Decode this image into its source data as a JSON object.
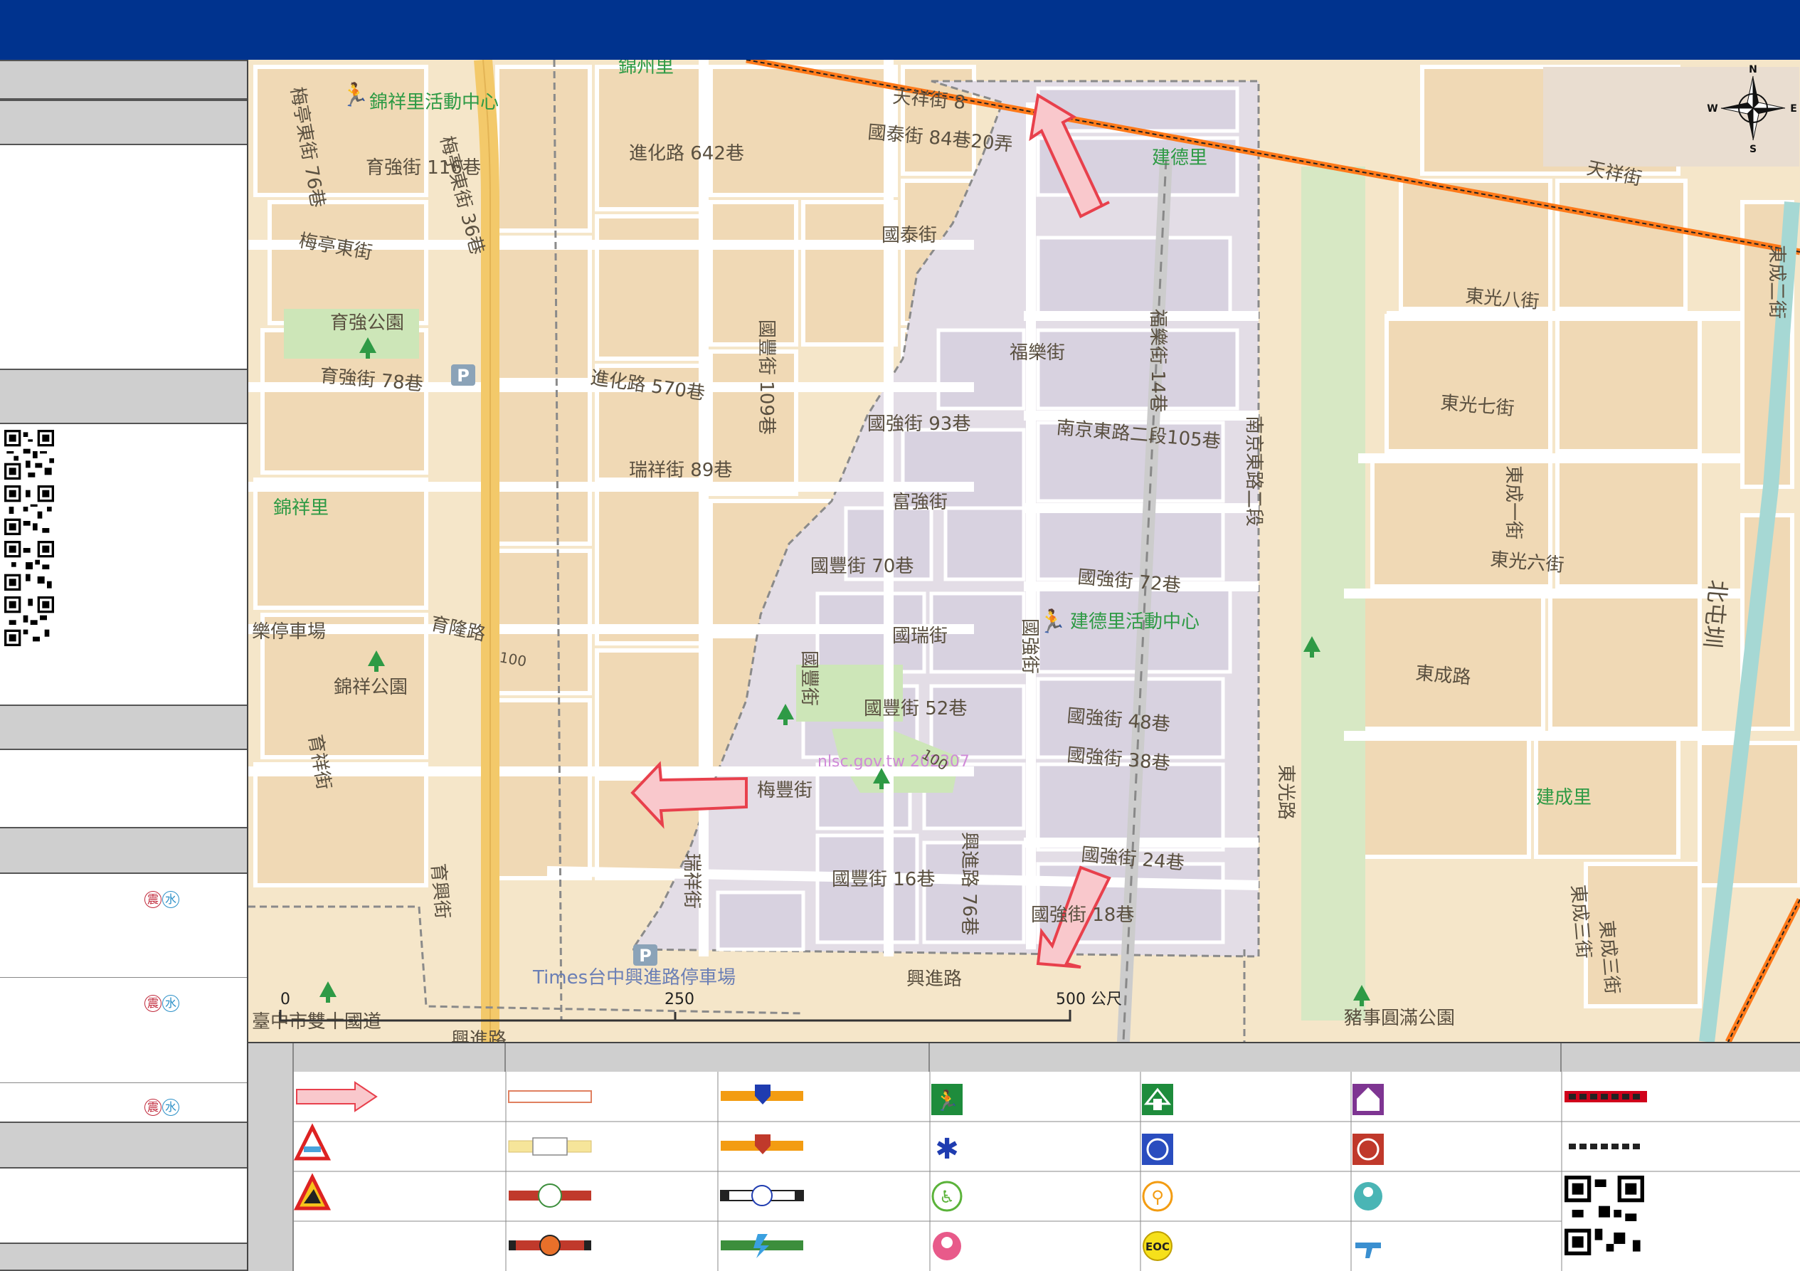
{
  "header": {
    "title": ""
  },
  "sidebar": {
    "sections": [
      "",
      "",
      "",
      "",
      "",
      "",
      ""
    ],
    "shelters": [
      {
        "quake": "震",
        "flood": "水"
      },
      {
        "quake": "震",
        "flood": "水"
      },
      {
        "quake": "震",
        "flood": "水"
      }
    ]
  },
  "map": {
    "labels": {
      "jinzhou": "錦州里",
      "tianxiang": "天祥街 8",
      "guotai_84": "國泰街 84巷20弄",
      "jiande_li": "建德里",
      "jinxiang_center": "錦祥里活動中心",
      "jinhua_642": "進化路 642巷",
      "yuqiang_116": "育強街\n116巷",
      "meiting_36": "梅亭東街 36巷",
      "meiting_76": "梅亭東街 76巷",
      "guotai": "國泰街",
      "meiting_e": "梅亭東街",
      "yuqiang_park": "育強公園",
      "guofeng_109": "國豐街 109巷",
      "fule_14": "福樂街 14巷",
      "fule": "福樂街",
      "yuqiang_78": "育強街 78巷",
      "jinhua_570": "進化路 570巷",
      "guoqiang_93": "國強街 93巷",
      "nanjing_105": "南京東路二段105巷",
      "nanjing_2": "南京東路二段",
      "ruixiang_89": "瑞祥街\n89巷",
      "fuqiang": "富強街",
      "jinxiang_li": "錦祥里",
      "guofeng_70": "國豐街 70巷",
      "guoqiang_72": "國強街 72巷",
      "jiande_center": "建德里活動中心",
      "guorui": "國瑞街",
      "guoqiang": "國強街",
      "yulong": "育隆路",
      "parking_le": "樂停車場",
      "jinxiang_park": "錦祥公園",
      "guofeng": "國豐街",
      "guofeng_52": "國豐街 52巷",
      "guoqiang_48": "國強街 48巷",
      "guoqiang_38": "國強街 38巷",
      "watermark": "nlsc.gov.tw 202307",
      "meifeng": "梅豐街",
      "xingjin_76": "興進路 76巷",
      "guoqiang_24": "國強街 24巷",
      "guofeng_16": "國豐街 16巷",
      "guoqiang_18": "國強街 18巷",
      "ruixiang": "瑞祥街",
      "yuxing": "育興街",
      "yuxiang": "育祥街",
      "times_parking": "Times台中興進路停車場",
      "xingjin": "興進路",
      "shuangshi": "臺中市雙十國道",
      "xingjin2": "興進路",
      "zhushi_park": "豬事圓滿公園",
      "dongguang_8": "東光八街",
      "dongguang_7": "東光七街",
      "dongguang_6": "東光六街",
      "dongcheng_1": "東成一街",
      "dongcheng_2": "東成二街",
      "dongcheng_road": "東成路",
      "dongguang_road": "東光路",
      "beitun": "北屯圳",
      "jiancheng_li": "建成里",
      "dongcheng_3": "東成三街",
      "dongcheng_3b": "東成三街",
      "tianxiang_e": "天祥街",
      "num_100a": "100",
      "num_100b": "100"
    },
    "scale": {
      "zero": "0",
      "mid": "250",
      "end": "500 公尺"
    },
    "compass": {
      "n": "N",
      "s": "S",
      "e": "E",
      "w": "W"
    }
  },
  "legend": {
    "headers": [
      "",
      "",
      "",
      ""
    ],
    "eoc": "EOC"
  },
  "colors": {
    "header": "#00338e",
    "map_bg": "#f5e6c9",
    "block": "#f0d9b5",
    "district": "#e3dde6",
    "road_major": "#f3c96a",
    "rail": "#ff7a1a",
    "evac_arrow": "#e8404c",
    "park": "#cde6b8",
    "label_green": "#2e9a45"
  }
}
